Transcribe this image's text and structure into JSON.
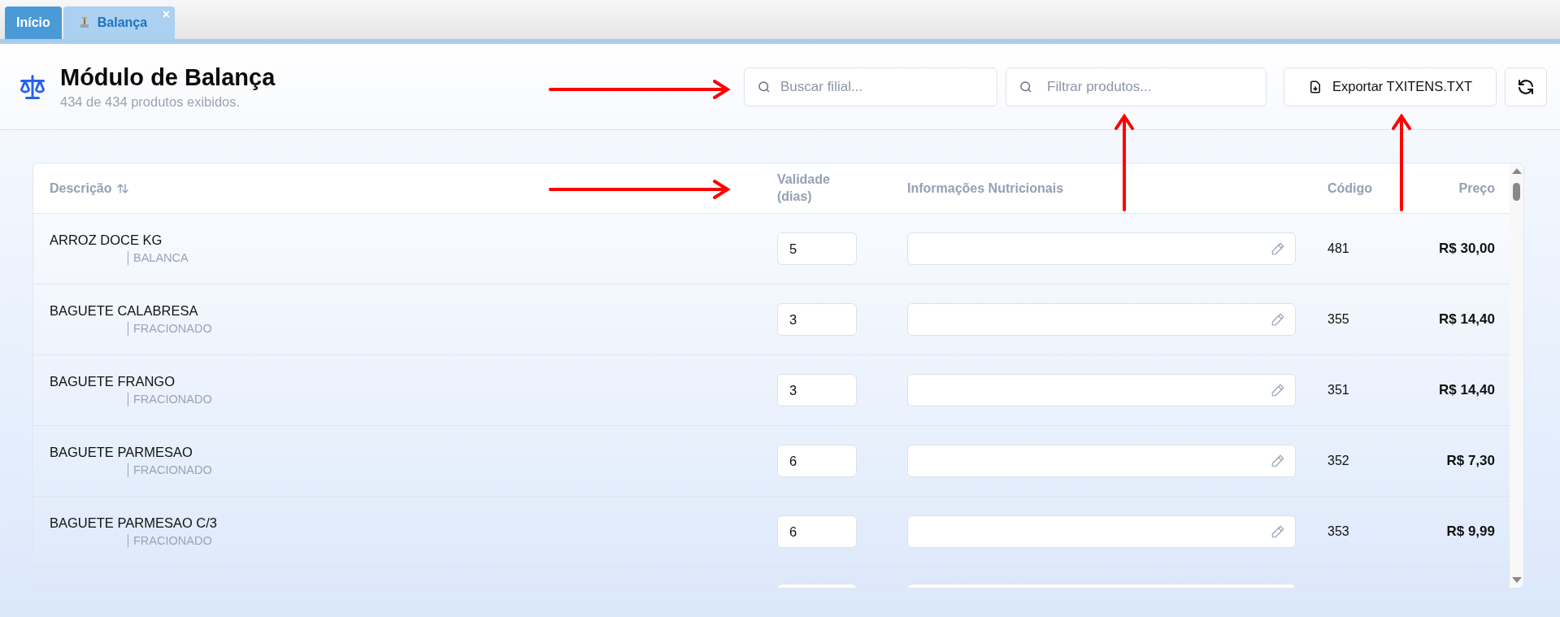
{
  "tabs": [
    {
      "label": "Início",
      "selected": false,
      "icon": false
    },
    {
      "label": "Balança",
      "selected": true,
      "icon": true,
      "close": "×"
    }
  ],
  "header": {
    "title": "Módulo de Balança",
    "subtitle": "434 de 434 produtos exibidos."
  },
  "search_branch": {
    "placeholder": "Buscar filial..."
  },
  "filter_products": {
    "placeholder": "Filtrar produtos..."
  },
  "export_button": {
    "label": "Exportar TXITENS.TXT"
  },
  "table": {
    "columns": [
      {
        "label": "Descrição",
        "sortable": true
      },
      {
        "label": "Validade (dias)",
        "sortable": false
      },
      {
        "label": "Informações Nutricionais",
        "sortable": false
      },
      {
        "label": "Código",
        "sortable": false
      },
      {
        "label": "Preço",
        "sortable": false
      }
    ],
    "rows": [
      {
        "description": "ARROZ DOCE KG",
        "type": "BALANCA",
        "validity": "5",
        "code": "481",
        "price": "R$ 30,00"
      },
      {
        "description": "BAGUETE CALABRESA",
        "type": "FRACIONADO",
        "validity": "3",
        "code": "355",
        "price": "R$ 14,40"
      },
      {
        "description": "BAGUETE FRANGO",
        "type": "FRACIONADO",
        "validity": "3",
        "code": "351",
        "price": "R$ 14,40"
      },
      {
        "description": "BAGUETE PARMESAO",
        "type": "FRACIONADO",
        "validity": "6",
        "code": "352",
        "price": "R$ 7,30"
      },
      {
        "description": "BAGUETE PARMESAO C/3",
        "type": "FRACIONADO",
        "validity": "6",
        "code": "353",
        "price": "R$ 9,99"
      }
    ]
  }
}
